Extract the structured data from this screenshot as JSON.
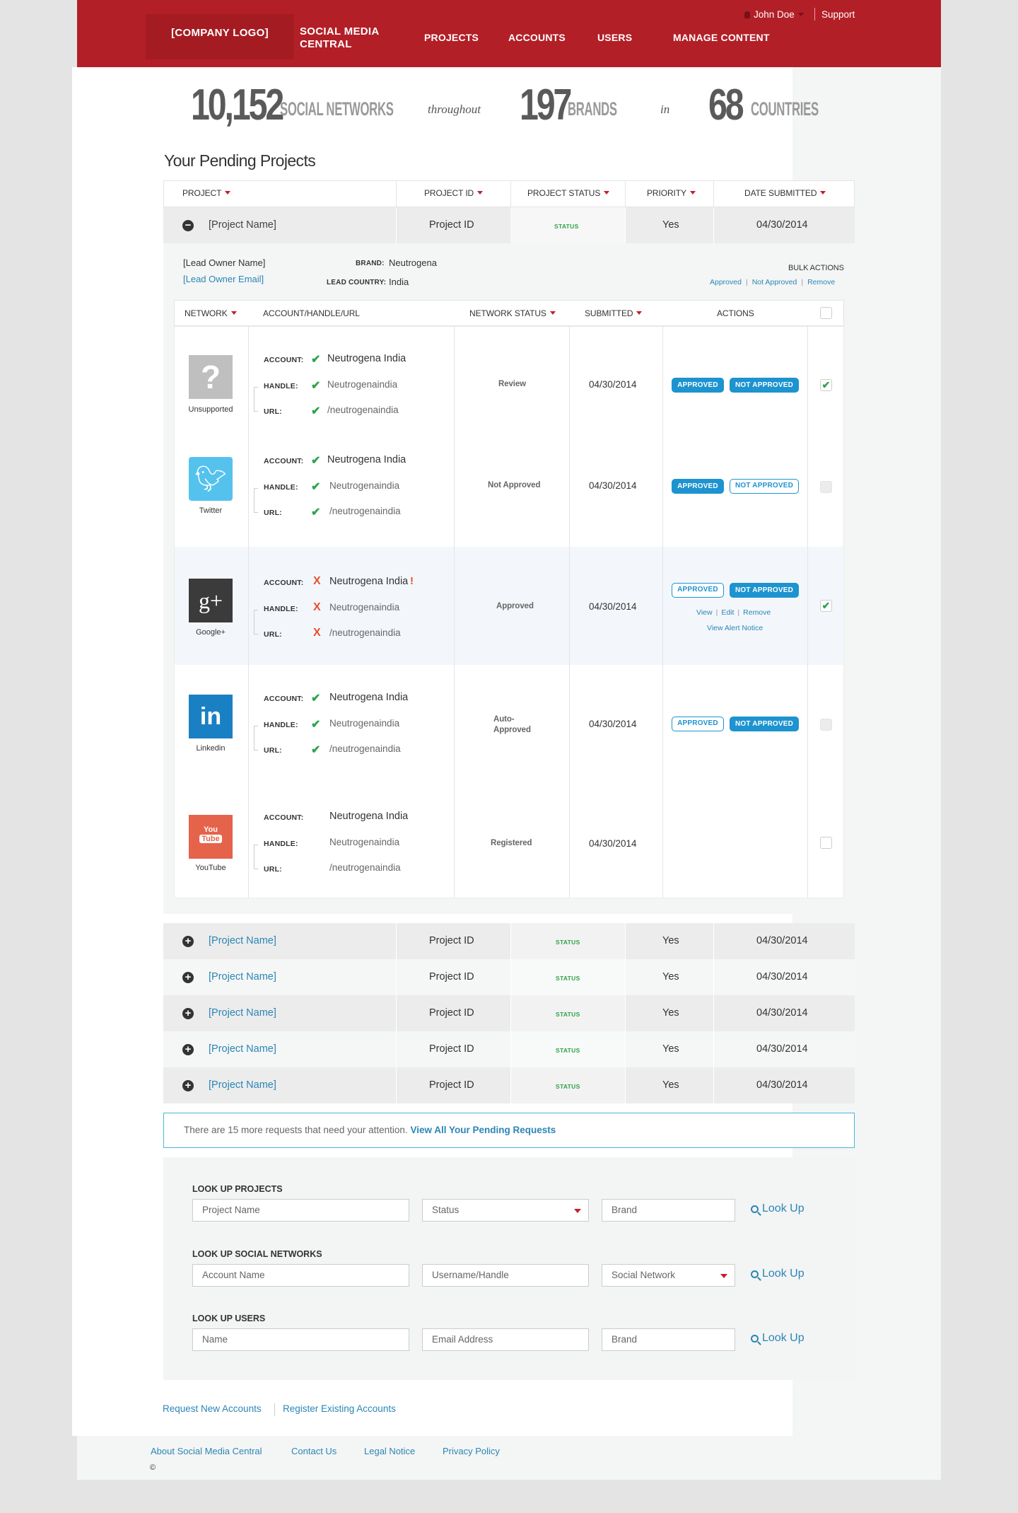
{
  "header": {
    "logo": "[COMPANY LOGO]",
    "app_line1": "SOCIAL MEDIA",
    "app_line2": "CENTRAL",
    "nav": [
      "PROJECTS",
      "ACCOUNTS",
      "USERS",
      "MANAGE CONTENT"
    ],
    "user": "John Doe",
    "support": "Support"
  },
  "stats": {
    "n1": "10,152",
    "w1": "SOCIAL NETWORKS",
    "c1": "throughout",
    "n2": "197",
    "w2": "BRANDS",
    "c2": "in",
    "n3": "68",
    "w3": "COUNTRIES"
  },
  "pending": {
    "title": "Your Pending Projects",
    "columns": [
      "PROJECT",
      "PROJECT ID",
      "PROJECT STATUS",
      "PRIORITY",
      "DATE SUBMITTED"
    ]
  },
  "expanded": {
    "name": "[Project Name]",
    "id": "Project ID",
    "status": "STATUS",
    "priority": "Yes",
    "date": "04/30/2014",
    "lead_name": "[Lead Owner Name]",
    "lead_email": "[Lead Owner Email]",
    "brand_label": "BRAND:",
    "brand": "Neutrogena",
    "country_label": "LEAD COUNTRY:",
    "country": "India",
    "bulk_title": "BULK ACTIONS",
    "bulk_approved": "Approved",
    "bulk_not": "Not Approved",
    "bulk_remove": "Remove",
    "net_columns": [
      "NETWORK",
      "ACCOUNT/HANDLE/URL",
      "NETWORK STATUS",
      "SUBMITTED",
      "ACTIONS"
    ],
    "labels": {
      "account": "ACCOUNT:",
      "handle": "HANDLE:",
      "url": "URL:"
    },
    "btn_approved": "APPROVED",
    "btn_not": "NOT APPROVED",
    "networks": [
      {
        "name": "Unsupported",
        "account": "Neutrogena India",
        "handle": "Neutrogenaindia",
        "url": "/neutrogenaindia",
        "status": "Review",
        "submitted": "04/30/2014"
      },
      {
        "name": "Twitter",
        "account": "Neutrogena India",
        "handle": "Neutrogenaindia",
        "url": "/neutrogenaindia",
        "status": "Not Approved",
        "submitted": "04/30/2014"
      },
      {
        "name": "Google+",
        "account": "Neutrogena India",
        "handle": "Neutrogenaindia",
        "url": "/neutrogenaindia",
        "status": "Approved",
        "submitted": "04/30/2014",
        "view": "View",
        "edit": "Edit",
        "remove": "Remove",
        "alert": "View Alert Notice"
      },
      {
        "name": "Linkedin",
        "account": "Neutrogena India",
        "handle": "Neutrogenaindia",
        "url": "/neutrogenaindia",
        "status_line1": "Auto-",
        "status_line2": "Approved",
        "submitted": "04/30/2014"
      },
      {
        "name": "YouTube",
        "account": "Neutrogena India",
        "handle": "Neutrogenaindia",
        "url": "/neutrogenaindia",
        "status": "Registered",
        "submitted": "04/30/2014"
      }
    ]
  },
  "other_projects": [
    {
      "name": "[Project Name]",
      "id": "Project ID",
      "status": "STATUS",
      "priority": "Yes",
      "date": "04/30/2014"
    },
    {
      "name": "[Project Name]",
      "id": "Project ID",
      "status": "STATUS",
      "priority": "Yes",
      "date": "04/30/2014"
    },
    {
      "name": "[Project Name]",
      "id": "Project ID",
      "status": "STATUS",
      "priority": "Yes",
      "date": "04/30/2014"
    },
    {
      "name": "[Project Name]",
      "id": "Project ID",
      "status": "STATUS",
      "priority": "Yes",
      "date": "04/30/2014"
    },
    {
      "name": "[Project Name]",
      "id": "Project ID",
      "status": "STATUS",
      "priority": "Yes",
      "date": "04/30/2014"
    }
  ],
  "notice": {
    "text": "There are 15 more requests that need your attention.",
    "link": "View All Your Pending Requests"
  },
  "lookup": {
    "projects_title": "LOOK UP PROJECTS",
    "p_name": "Project Name",
    "p_status": "Status",
    "p_brand": "Brand",
    "networks_title": "LOOK UP SOCIAL NETWORKS",
    "n_account": "Account Name",
    "n_user": "Username/Handle",
    "n_net": "Social Network",
    "users_title": "LOOK UP USERS",
    "u_name": "Name",
    "u_email": "Email Address",
    "u_brand": "Brand",
    "button": "Look Up"
  },
  "bottom_links": {
    "request": "Request New Accounts",
    "register": "Register Existing Accounts"
  },
  "footer": {
    "about": "About Social Media Central",
    "contact": "Contact Us",
    "legal": "Legal Notice",
    "privacy": "Privacy Policy",
    "copyright": "©"
  },
  "colors": {
    "brand_red": "#b31f27",
    "link_blue": "#2a86b5",
    "button_blue": "#1d93cf",
    "approved_green": "#2fa34b",
    "error_red": "#e5502e"
  }
}
